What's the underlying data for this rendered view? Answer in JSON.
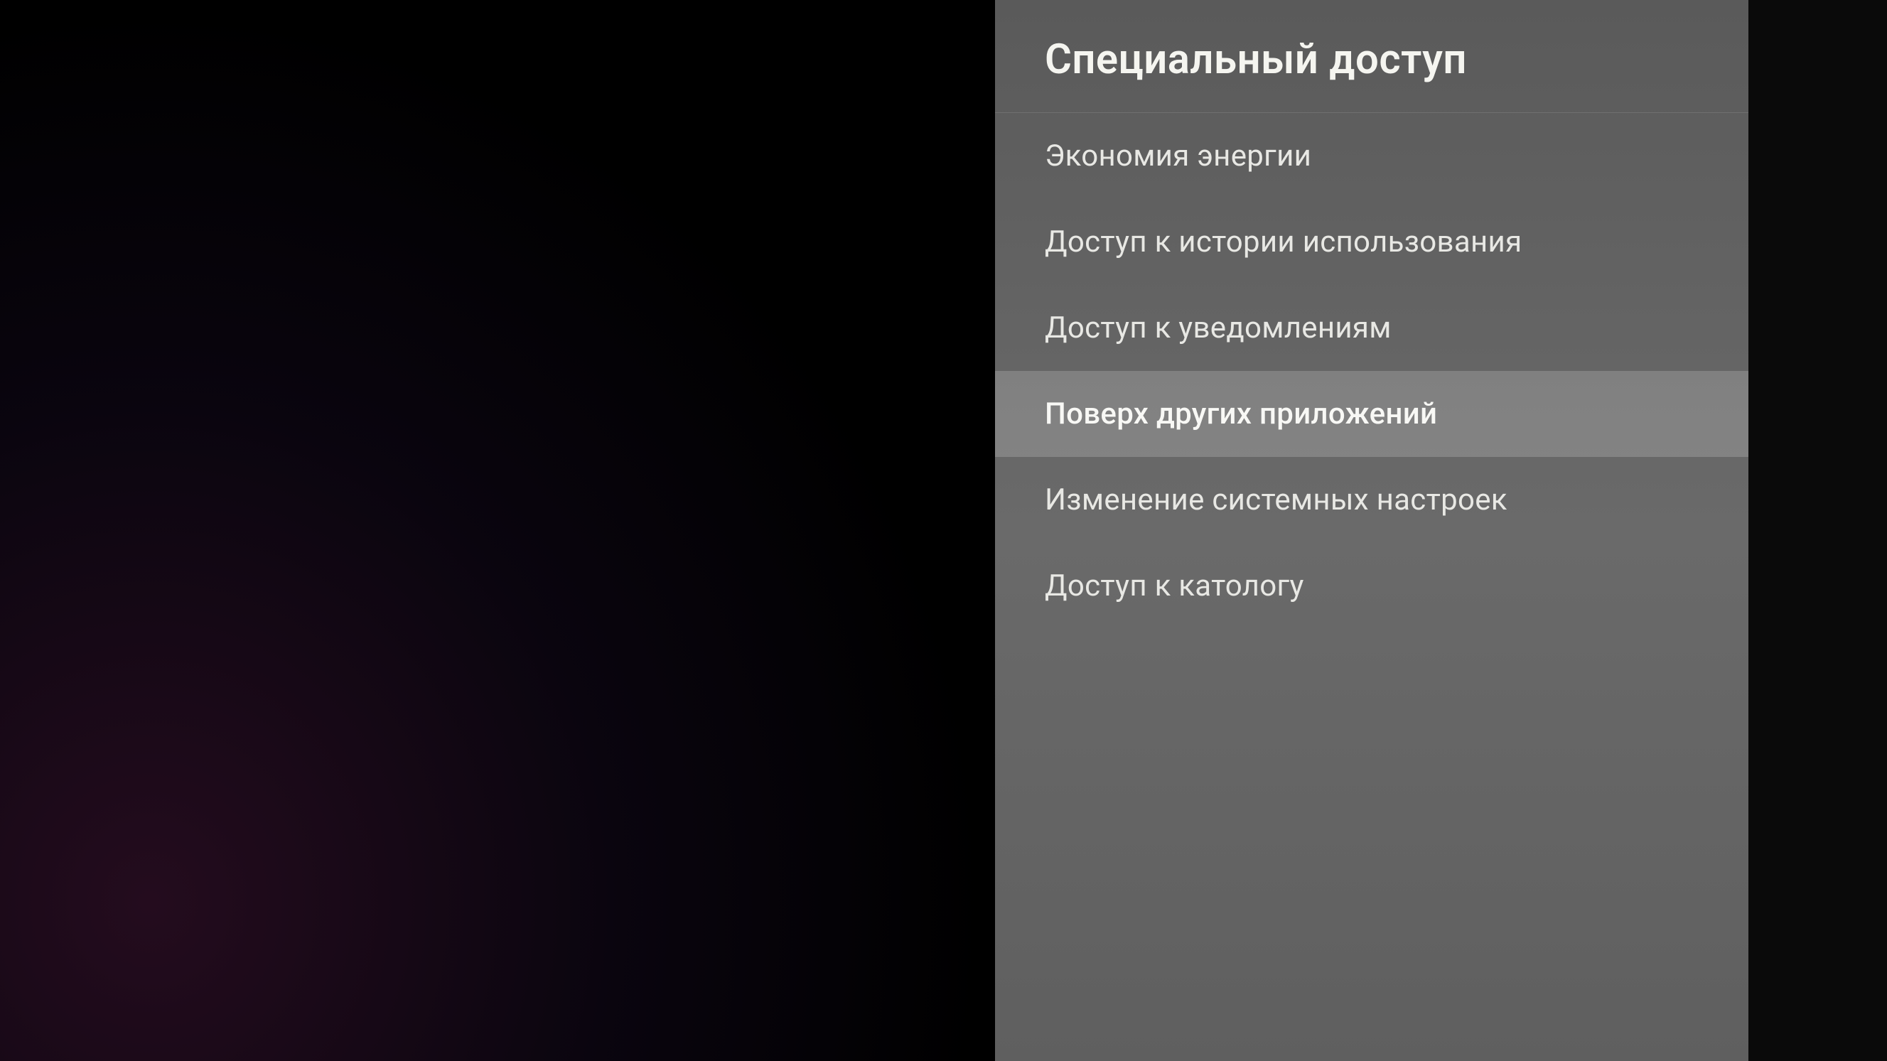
{
  "panel": {
    "title": "Специальный доступ",
    "items": [
      {
        "label": "Экономия энергии",
        "selected": false
      },
      {
        "label": "Доступ к истории использования",
        "selected": false
      },
      {
        "label": "Доступ к уведомлениям",
        "selected": false
      },
      {
        "label": "Поверх других приложений",
        "selected": true
      },
      {
        "label": "Изменение системных настроек",
        "selected": false
      },
      {
        "label": "Доступ к катологу",
        "selected": false
      }
    ]
  }
}
